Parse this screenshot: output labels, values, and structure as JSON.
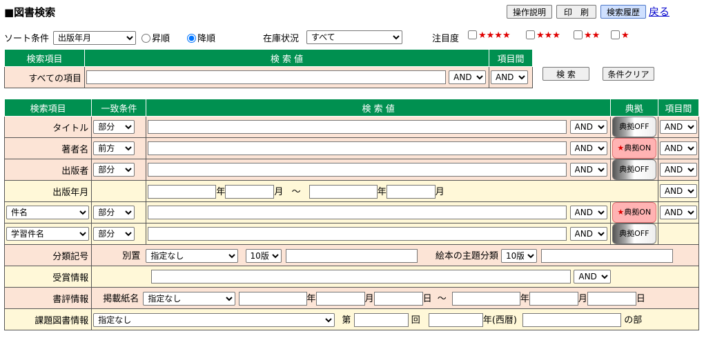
{
  "title": "■図書検索",
  "top_buttons": {
    "manual": "操作説明",
    "print": "印　刷",
    "history": "検索履歴",
    "back": "戻る"
  },
  "sort": {
    "label": "ソート条件",
    "value": "出版年月",
    "asc": "昇順",
    "desc": "降順"
  },
  "stock": {
    "label": "在庫状況",
    "value": "すべて"
  },
  "attention": {
    "label": "注目度",
    "s4": "★★★★",
    "s3": "★★★",
    "s2": "★★",
    "s1": "★"
  },
  "simple": {
    "h_item": "検索項目",
    "h_value": "検 索 値",
    "h_between": "項目間",
    "row_label": "すべての項目",
    "op": "AND",
    "between": "AND",
    "search_btn": "検 索",
    "clear_btn": "条件クリア"
  },
  "detail": {
    "h_item": "検索項目",
    "h_match": "一致条件",
    "h_value": "検 索 値",
    "h_source": "典拠",
    "h_between": "項目間",
    "rows": [
      {
        "label": "タイトル",
        "match": "部分",
        "op": "AND",
        "toggle": "典拠OFF",
        "between": "AND"
      },
      {
        "label": "著者名",
        "match": "前方",
        "op": "AND",
        "toggle": "典拠ON",
        "between": "AND"
      },
      {
        "label": "出版者",
        "match": "部分",
        "op": "AND",
        "toggle": "典拠OFF",
        "between": "AND"
      }
    ],
    "pubdate": {
      "label": "出版年月",
      "year": "年",
      "month": "月",
      "tilde": "〜",
      "between": "AND"
    },
    "subject_rows": [
      {
        "field": "件名",
        "match": "部分",
        "op": "AND",
        "toggle": "典拠ON",
        "between": "AND"
      },
      {
        "field": "学習件名",
        "match": "部分",
        "op": "AND",
        "toggle": "典拠OFF"
      }
    ],
    "classification": {
      "label": "分類記号",
      "betsu": "別置",
      "betsu_value": "指定なし",
      "edition": "10版",
      "picture_label": "絵本の主題分類",
      "picture_edition": "10版"
    },
    "award": {
      "label": "受賞情報",
      "op": "AND"
    },
    "review": {
      "label": "書評情報",
      "paper_label": "掲載紙名",
      "paper_value": "指定なし",
      "year": "年",
      "month": "月",
      "day": "日",
      "tilde": "〜"
    },
    "assigned": {
      "label": "課題図書情報",
      "value": "指定なし",
      "dai": "第",
      "kai": "回",
      "year": "年(西暦)",
      "bu": "の部"
    }
  }
}
